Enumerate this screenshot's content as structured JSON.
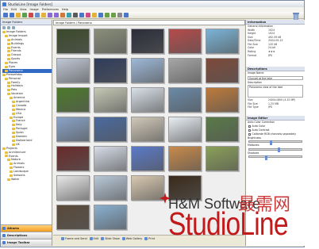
{
  "window": {
    "title": "StudioLine [Image Folders]"
  },
  "menu": [
    "File",
    "Edit",
    "View",
    "Image",
    "Preferences",
    "Help"
  ],
  "left_panel": {
    "header": "Image Folders",
    "tree": [
      {
        "label": "Image Folders",
        "indent": 0
      },
      {
        "label": "Image Import",
        "indent": 1
      },
      {
        "label": "Animals",
        "indent": 2
      },
      {
        "label": "Buildings",
        "indent": 2
      },
      {
        "label": "Events",
        "indent": 2
      },
      {
        "label": "Friends",
        "indent": 2
      },
      {
        "label": "Groups",
        "indent": 2
      },
      {
        "label": "Sports",
        "indent": 2
      },
      {
        "label": "Places",
        "indent": 1
      },
      {
        "label": "Eyes",
        "indent": 1
      },
      {
        "label": "Panorama",
        "indent": 1,
        "selected": true
      },
      {
        "label": "Pressefotos",
        "indent": 0
      },
      {
        "label": "Personal",
        "indent": 1
      },
      {
        "label": "Family",
        "indent": 2
      },
      {
        "label": "Holidays",
        "indent": 2
      },
      {
        "label": "Pets",
        "indent": 2
      },
      {
        "label": "Vacation",
        "indent": 2
      },
      {
        "label": "America",
        "indent": 3
      },
      {
        "label": "Argentina",
        "indent": 4
      },
      {
        "label": "Canada",
        "indent": 4
      },
      {
        "label": "Mexico",
        "indent": 4
      },
      {
        "label": "USA",
        "indent": 4
      },
      {
        "label": "Europe",
        "indent": 3
      },
      {
        "label": "France",
        "indent": 4
      },
      {
        "label": "Italy",
        "indent": 4
      },
      {
        "label": "Portugal",
        "indent": 4
      },
      {
        "label": "Spain",
        "indent": 4
      },
      {
        "label": "Sweden",
        "indent": 4
      },
      {
        "label": "Switzerland",
        "indent": 4
      },
      {
        "label": "UK",
        "indent": 4
      },
      {
        "label": "Projects",
        "indent": 0
      },
      {
        "label": "Architecture",
        "indent": 1
      },
      {
        "label": "Events",
        "indent": 1
      },
      {
        "label": "Nature",
        "indent": 2
      },
      {
        "label": "Animals",
        "indent": 3
      },
      {
        "label": "Flowers",
        "indent": 3
      },
      {
        "label": "Landscape",
        "indent": 3
      },
      {
        "label": "Seasons",
        "indent": 3
      },
      {
        "label": "Water",
        "indent": 2
      }
    ],
    "tabs": [
      {
        "label": "Albums",
        "active": true
      },
      {
        "label": "Descriptions",
        "active": false
      },
      {
        "label": "Image Toolbar",
        "active": false
      }
    ]
  },
  "address_bar": {
    "text": "Image Folders / Panorama"
  },
  "thumbnails": [
    [
      "#3a4a2a",
      "#8a8f7a",
      "#2a2d3a",
      "#b74a4a",
      "#7ab4d8"
    ],
    [
      "#c0c8d6",
      "#2f3d5c",
      "#9db8d8",
      "#a6a6a6",
      "#7d4a3a"
    ],
    [
      "#4c7a2a",
      "#c4c8b4",
      "#d8e0e8",
      "#6a8aa8",
      "#bd7a3a"
    ],
    [
      "#8aa4c8",
      "#4a6aa0",
      "#d0c8b8",
      "#e8eef4",
      "#5a7a48"
    ],
    [
      "#6a2a2a",
      "#d6dce8",
      "#5a7ac8",
      "#c88a4a",
      "#8aa058"
    ],
    [
      "#e8e8e8",
      "#b8c8d8",
      "#d8c8b0",
      "#3a2a1a",
      "#ffffff"
    ],
    [
      "#5a4a3a",
      "#8ab0d0",
      "#ffffff",
      "#ffffff",
      "#ffffff"
    ]
  ],
  "bottom_bar": [
    "Frame and Send",
    "Edit",
    "Slide Show",
    "Web Gallery",
    "Print"
  ],
  "right_panel": {
    "info_header": "Information",
    "info_title": "General Information",
    "info_rows": [
      {
        "k": "Width",
        "v": "1024"
      },
      {
        "k": "Height",
        "v": "1024"
      },
      {
        "k": "Size",
        "v": "492.59 kB"
      },
      {
        "k": "Date/Time",
        "v": "2004-09-15"
      },
      {
        "k": "File Size",
        "v": "120 kB"
      },
      {
        "k": "Color",
        "v": "24-bit"
      },
      {
        "k": "Rating",
        "v": "★★★"
      },
      {
        "k": "Format",
        "v": "JPG"
      }
    ],
    "descriptions_header": "Descriptions",
    "image_name_label": "Image Name",
    "image_name_value": "Sunset at the lake",
    "description_label": "Description",
    "description_value": "Panorama view of the lake",
    "meta_rows": [
      {
        "k": "Size",
        "v": "2400x1800 (4.32 MP)"
      },
      {
        "k": "File Size",
        "v": "1.25 MB"
      },
      {
        "k": "File Type",
        "v": "JPG"
      }
    ],
    "editor_header": "Image Editor",
    "editor_sub": "Auto Color Correction",
    "checks": [
      "Auto Color",
      "Auto Contrast",
      "Calibrate RGB channels separately"
    ],
    "slider_label_1": "Brightness",
    "slider_label_2": "Midtones",
    "slider_label_3": "Shadows"
  },
  "branding": {
    "company": "H&M Software",
    "product": "StudioLine",
    "watermark": "最需网"
  },
  "colors": {
    "accent": "#316ac5",
    "brand_red": "#c21a1a",
    "active_tab": "#f29d1f"
  }
}
